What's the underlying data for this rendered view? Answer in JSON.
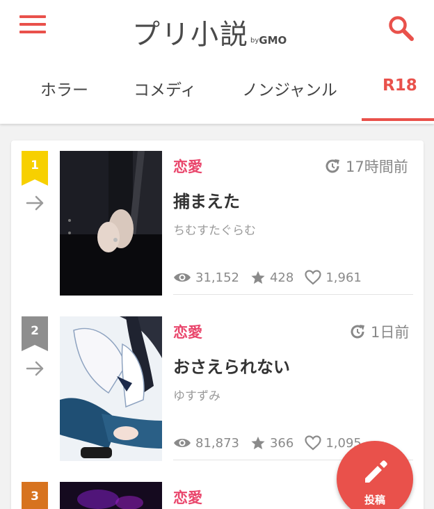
{
  "header": {
    "logo_text": "プリ小説",
    "logo_by": "by",
    "logo_gmo": "GMO"
  },
  "tabs": [
    {
      "label": "ホラー",
      "active": false
    },
    {
      "label": "コメディ",
      "active": false
    },
    {
      "label": "ノンジャンル",
      "active": false
    },
    {
      "label": "R18",
      "active": true
    }
  ],
  "stories": [
    {
      "rank": "1",
      "genre": "恋愛",
      "time": "17時間前",
      "title": "捕まえた",
      "author": "ちむすたぐらむ",
      "views": "31,152",
      "stars": "428",
      "likes": "1,961"
    },
    {
      "rank": "2",
      "genre": "恋愛",
      "time": "1日前",
      "title": "おさえられない",
      "author": "ゆすずみ",
      "views": "81,873",
      "stars": "366",
      "likes": "1,095"
    },
    {
      "rank": "3",
      "genre": "恋愛"
    }
  ],
  "fab": {
    "label": "投稿"
  },
  "colors": {
    "accent": "#e9514b",
    "genre": "#e9456b",
    "rank1": "#f7d000",
    "rank2": "#8e8e8e",
    "rank3": "#d7731f"
  }
}
